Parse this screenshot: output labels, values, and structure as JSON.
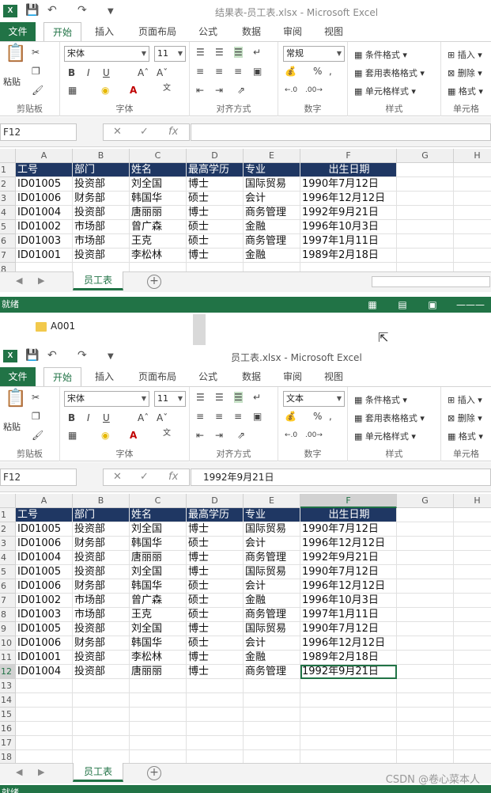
{
  "window1": {
    "title": "结果表-员工表.xlsx - Microsoft Excel",
    "tabs": [
      "文件",
      "开始",
      "插入",
      "页面布局",
      "公式",
      "数据",
      "审阅",
      "视图"
    ],
    "name_box": "F12",
    "formula": "",
    "font": "宋体",
    "font_size": "11",
    "number_format": "常规",
    "columns": [
      "A",
      "B",
      "C",
      "D",
      "E",
      "F",
      "G",
      "H"
    ],
    "headers": [
      "工号",
      "部门",
      "姓名",
      "最高学历",
      "专业",
      "出生日期"
    ],
    "rows": [
      [
        "ID01005",
        "投资部",
        "刘全国",
        "博士",
        "国际贸易",
        "1990年7月12日"
      ],
      [
        "ID01006",
        "财务部",
        "韩国华",
        "硕士",
        "会计",
        "1996年12月12日"
      ],
      [
        "ID01004",
        "投资部",
        "唐丽丽",
        "博士",
        "商务管理",
        "1992年9月21日"
      ],
      [
        "ID01002",
        "市场部",
        "曾广森",
        "硕士",
        "金融",
        "1996年10月3日"
      ],
      [
        "ID01003",
        "市场部",
        "王克",
        "硕士",
        "商务管理",
        "1997年1月11日"
      ],
      [
        "ID01001",
        "投资部",
        "李松林",
        "博士",
        "金融",
        "1989年2月18日"
      ]
    ],
    "row_numbers": [
      "1",
      "2",
      "3",
      "4",
      "5",
      "6",
      "7",
      "8"
    ],
    "sheet_tab": "员工表",
    "status": "就绪"
  },
  "explorer": {
    "folder": "A001"
  },
  "window2": {
    "title": "员工表.xlsx - Microsoft Excel",
    "tabs": [
      "文件",
      "开始",
      "插入",
      "页面布局",
      "公式",
      "数据",
      "审阅",
      "视图"
    ],
    "name_box": "F12",
    "formula": "1992年9月21日",
    "font": "宋体",
    "font_size": "11",
    "number_format": "文本",
    "columns": [
      "A",
      "B",
      "C",
      "D",
      "E",
      "F",
      "G",
      "H"
    ],
    "headers": [
      "工号",
      "部门",
      "姓名",
      "最高学历",
      "专业",
      "出生日期"
    ],
    "rows": [
      [
        "ID01005",
        "投资部",
        "刘全国",
        "博士",
        "国际贸易",
        "1990年7月12日"
      ],
      [
        "ID01006",
        "财务部",
        "韩国华",
        "硕士",
        "会计",
        "1996年12月12日"
      ],
      [
        "ID01004",
        "投资部",
        "唐丽丽",
        "博士",
        "商务管理",
        "1992年9月21日"
      ],
      [
        "ID01005",
        "投资部",
        "刘全国",
        "博士",
        "国际贸易",
        "1990年7月12日"
      ],
      [
        "ID01006",
        "财务部",
        "韩国华",
        "硕士",
        "会计",
        "1996年12月12日"
      ],
      [
        "ID01002",
        "市场部",
        "曾广森",
        "硕士",
        "金融",
        "1996年10月3日"
      ],
      [
        "ID01003",
        "市场部",
        "王克",
        "硕士",
        "商务管理",
        "1997年1月11日"
      ],
      [
        "ID01005",
        "投资部",
        "刘全国",
        "博士",
        "国际贸易",
        "1990年7月12日"
      ],
      [
        "ID01006",
        "财务部",
        "韩国华",
        "硕士",
        "会计",
        "1996年12月12日"
      ],
      [
        "ID01001",
        "投资部",
        "李松林",
        "博士",
        "金融",
        "1989年2月18日"
      ],
      [
        "ID01004",
        "投资部",
        "唐丽丽",
        "博士",
        "商务管理",
        "1992年9月21日"
      ]
    ],
    "row_numbers": [
      "1",
      "2",
      "3",
      "4",
      "5",
      "6",
      "7",
      "8",
      "9",
      "10",
      "11",
      "12",
      "13",
      "14",
      "15",
      "16",
      "17",
      "18"
    ],
    "sheet_tab": "员工表",
    "status": "就绪"
  },
  "ribbon": {
    "paste": "粘贴",
    "clipboard": "剪贴板",
    "font_group": "字体",
    "align_group": "对齐方式",
    "number_group": "数字",
    "style_group": "样式",
    "cells_group": "单元格",
    "cond_format": "条件格式",
    "table_format": "套用表格格式",
    "cell_style": "单元格样式",
    "insert": "插入",
    "delete": "删除",
    "format": "格式"
  },
  "watermark": "CSDN @卷心菜本人",
  "colors": {
    "excel_green": "#217346",
    "header_fill": "#1f3763"
  }
}
